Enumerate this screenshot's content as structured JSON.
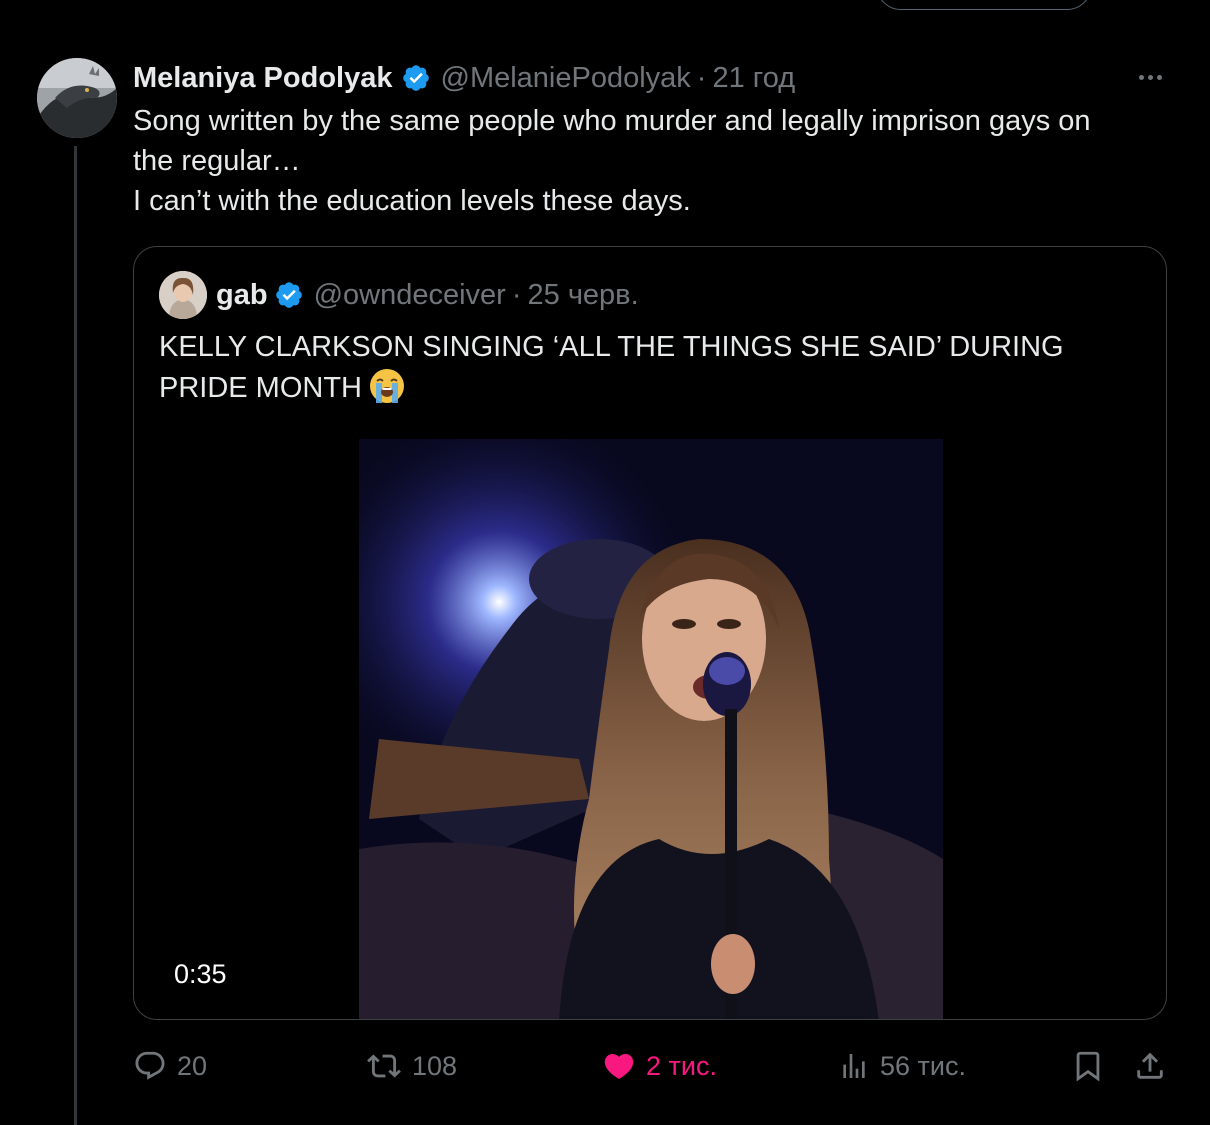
{
  "tweet": {
    "author_name": "Melaniya Podolyak",
    "handle": "@MelaniePodolyak",
    "separator": "·",
    "time": "21 год",
    "text_lines": [
      "Song written by the same people who murder and legally imprison gays on",
      "the regular…",
      "I can’t with the education levels these days."
    ]
  },
  "quote": {
    "author_name": "gab",
    "handle": "@owndeceiver",
    "separator": "·",
    "time": "25 черв.",
    "text_lines": [
      "KELLY CLARKSON SINGING ‘ALL THE THINGS SHE SAID’ DURING",
      "PRIDE MONTH"
    ],
    "video_duration": "0:35"
  },
  "actions": {
    "replies": "20",
    "reposts": "108",
    "likes": "2 тис.",
    "views": "56 тис."
  },
  "icons": {
    "verified": "verified-badge-icon",
    "more": "more-icon",
    "reply": "reply-icon",
    "repost": "repost-icon",
    "like": "heart-icon",
    "views": "views-icon",
    "bookmark": "bookmark-icon",
    "share": "share-icon",
    "emoji": "loudly-crying-face-emoji"
  },
  "colors": {
    "background": "#000000",
    "text": "#e7e9ea",
    "muted": "#71767b",
    "verified": "#1d9bf0",
    "like": "#f91880",
    "border": "#3e4144"
  }
}
